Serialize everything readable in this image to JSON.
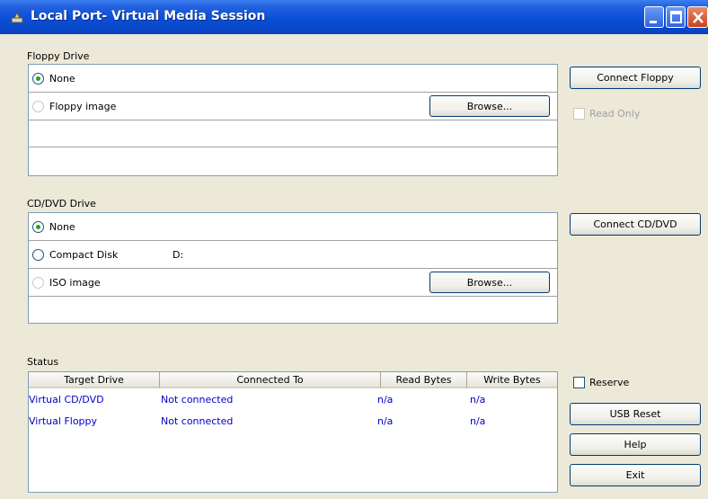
{
  "window": {
    "title": "Local Port- Virtual Media Session"
  },
  "floppy": {
    "section_label": "Floppy Drive",
    "none_label": "None",
    "image_label": "Floppy image",
    "browse_label": "Browse...",
    "connect_label": "Connect Floppy",
    "readonly_label": "Read Only"
  },
  "cd": {
    "section_label": "CD/DVD Drive",
    "none_label": "None",
    "compact_label": "Compact Disk",
    "compact_drive": "D:",
    "iso_label": "ISO image",
    "browse_label": "Browse...",
    "connect_label": "Connect CD/DVD"
  },
  "status": {
    "section_label": "Status",
    "columns": [
      "Target Drive",
      "Connected To",
      "Read Bytes",
      "Write Bytes"
    ],
    "rows": [
      [
        "Virtual CD/DVD",
        "Not connected",
        "n/a",
        "n/a"
      ],
      [
        "Virtual Floppy",
        "Not connected",
        "n/a",
        "n/a"
      ]
    ]
  },
  "side": {
    "reserve_label": "Reserve",
    "usb_reset_label": "USB Reset",
    "help_label": "Help",
    "exit_label": "Exit"
  },
  "colors": {
    "link_text": "#0000cc",
    "radio_selected": "#21a121",
    "titlebar": "#0a4fd6"
  }
}
